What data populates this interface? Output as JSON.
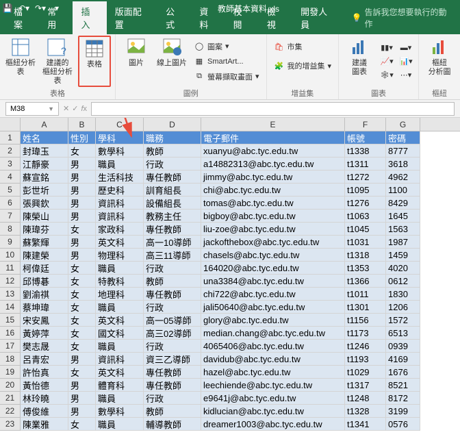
{
  "titlebar": {
    "filename": "教師基本資料.xls",
    "save": "儲存",
    "undo": "復原",
    "redo": "取消復原"
  },
  "menu": {
    "tabs": [
      "檔案",
      "常用",
      "插入",
      "版面配置",
      "公式",
      "資料",
      "校閱",
      "檢視",
      "開發人員"
    ],
    "activeIndex": 2,
    "tellme": "告訴我您想要執行的動作"
  },
  "ribbon": {
    "groups": {
      "tables": {
        "label": "表格",
        "pivot": "樞紐分析表",
        "recommended": "建議的\n樞紐分析表",
        "table": "表格"
      },
      "illustrations": {
        "label": "圖例",
        "picture": "圖片",
        "online": "線上圖片",
        "shapes": "圖案",
        "smartart": "SmartArt...",
        "screenshot": "螢幕擷取畫面"
      },
      "addins": {
        "label": "增益集",
        "store": "市集",
        "myAddins": "我的增益集"
      },
      "charts": {
        "label": "圖表",
        "recommended": "建議\n圖表"
      },
      "sparklines": {
        "label": "樞紐",
        "pivotChart": "樞紐\n分析圖"
      }
    }
  },
  "namebox": {
    "value": "M38"
  },
  "columns": {
    "letters": [
      "A",
      "B",
      "C",
      "D",
      "E",
      "F",
      "G"
    ],
    "widths": [
      70,
      40,
      70,
      84,
      210,
      60,
      50
    ]
  },
  "headers": [
    "姓名",
    "性別",
    "學科",
    "職務",
    "電子郵件",
    "帳號",
    "密碼"
  ],
  "data": [
    [
      "封瑋玉",
      "女",
      "數學科",
      "教師",
      "xuanyu@abc.tyc.edu.tw",
      "t1338",
      "8777"
    ],
    [
      "江靜豪",
      "男",
      "職員",
      "行政",
      "a14882313@abc.tyc.edu.tw",
      "t1311",
      "3618"
    ],
    [
      "蘇宣銘",
      "男",
      "生活科技",
      "專任教師",
      "jimmy@abc.tyc.edu.tw",
      "t1272",
      "4962"
    ],
    [
      "彭世圻",
      "男",
      "歷史科",
      "訓育組長",
      "chi@abc.tyc.edu.tw",
      "t1095",
      "1100"
    ],
    [
      "張興欽",
      "男",
      "資訊科",
      "設備組長",
      "tomas@abc.tyc.edu.tw",
      "t1276",
      "8429"
    ],
    [
      "陳榮山",
      "男",
      "資訊科",
      "教務主任",
      "bigboy@abc.tyc.edu.tw",
      "t1063",
      "1645"
    ],
    [
      "陳瑋芬",
      "女",
      "家政科",
      "專任教師",
      "liu-zoe@abc.tyc.edu.tw",
      "t1045",
      "1563"
    ],
    [
      "蘇繁輝",
      "男",
      "英文科",
      "高一10導師",
      "jackofthebox@abc.tyc.edu.tw",
      "t1031",
      "1987"
    ],
    [
      "陳建榮",
      "男",
      "物理科",
      "高三11導師",
      "chasels@abc.tyc.edu.tw",
      "t1318",
      "1459"
    ],
    [
      "柯偉廷",
      "女",
      "職員",
      "行政",
      "164020@abc.tyc.edu.tw",
      "t1353",
      "4020"
    ],
    [
      "邱博碁",
      "女",
      "特教科",
      "教師",
      "una3384@abc.tyc.edu.tw",
      "t1366",
      "0612"
    ],
    [
      "劉渝祺",
      "女",
      "地理科",
      "專任教師",
      "chi722@abc.tyc.edu.tw",
      "t1011",
      "1830"
    ],
    [
      "蔡坤瑋",
      "女",
      "職員",
      "行政",
      "jali50640@abc.tyc.edu.tw",
      "t1301",
      "1206"
    ],
    [
      "宋安鳳",
      "女",
      "英文科",
      "高一05導師",
      "glory@abc.tyc.edu.tw",
      "t1156",
      "1572"
    ],
    [
      "黃婷萍",
      "女",
      "國文科",
      "高三02導師",
      "median.chang@abc.tyc.edu.tw",
      "t1173",
      "6513"
    ],
    [
      "樊志晟",
      "女",
      "職員",
      "行政",
      "4065406@abc.tyc.edu.tw",
      "t1246",
      "0939"
    ],
    [
      "呂青宏",
      "男",
      "資訊科",
      "資三乙導師",
      "davidub@abc.tyc.edu.tw",
      "t1193",
      "4169"
    ],
    [
      "許怡真",
      "女",
      "英文科",
      "專任教師",
      "hazel@abc.tyc.edu.tw",
      "t1029",
      "1676"
    ],
    [
      "黃怡德",
      "男",
      "體育科",
      "專任教師",
      "leechiende@abc.tyc.edu.tw",
      "t1317",
      "8521"
    ],
    [
      "林玲曉",
      "男",
      "職員",
      "行政",
      "e9641j@abc.tyc.edu.tw",
      "t1248",
      "8172"
    ],
    [
      "傅俊維",
      "男",
      "數學科",
      "教師",
      "kidlucian@abc.tyc.edu.tw",
      "t1328",
      "3199"
    ],
    [
      "陳業雅",
      "女",
      "職員",
      "輔導教師",
      "dreamer1003@abc.tyc.edu.tw",
      "t1341",
      "0576"
    ]
  ]
}
